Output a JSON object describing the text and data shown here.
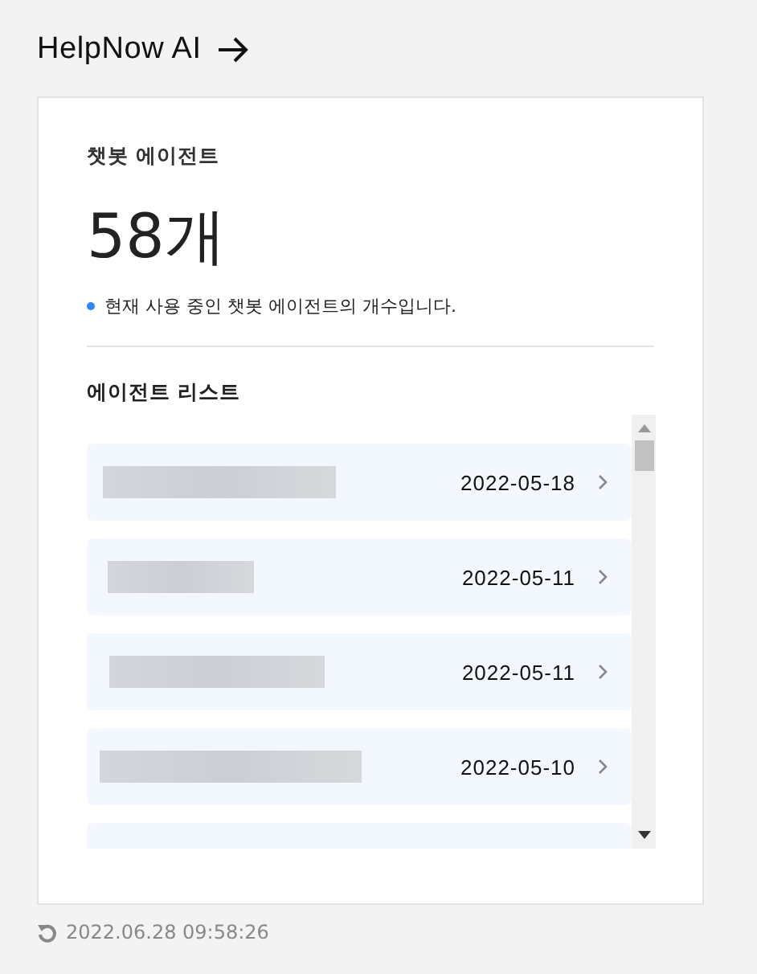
{
  "header": {
    "title": "HelpNow AI"
  },
  "card": {
    "label": "챗봇 에이전트",
    "count": "58개",
    "note": "현재 사용 중인 챗봇 에이전트의 개수입니다.",
    "list_title": "에이전트 리스트",
    "agents": [
      {
        "date": "2022-05-18"
      },
      {
        "date": "2022-05-11"
      },
      {
        "date": "2022-05-11"
      },
      {
        "date": "2022-05-10"
      }
    ]
  },
  "footer": {
    "updated": "2022.06.28 09:58:26"
  }
}
